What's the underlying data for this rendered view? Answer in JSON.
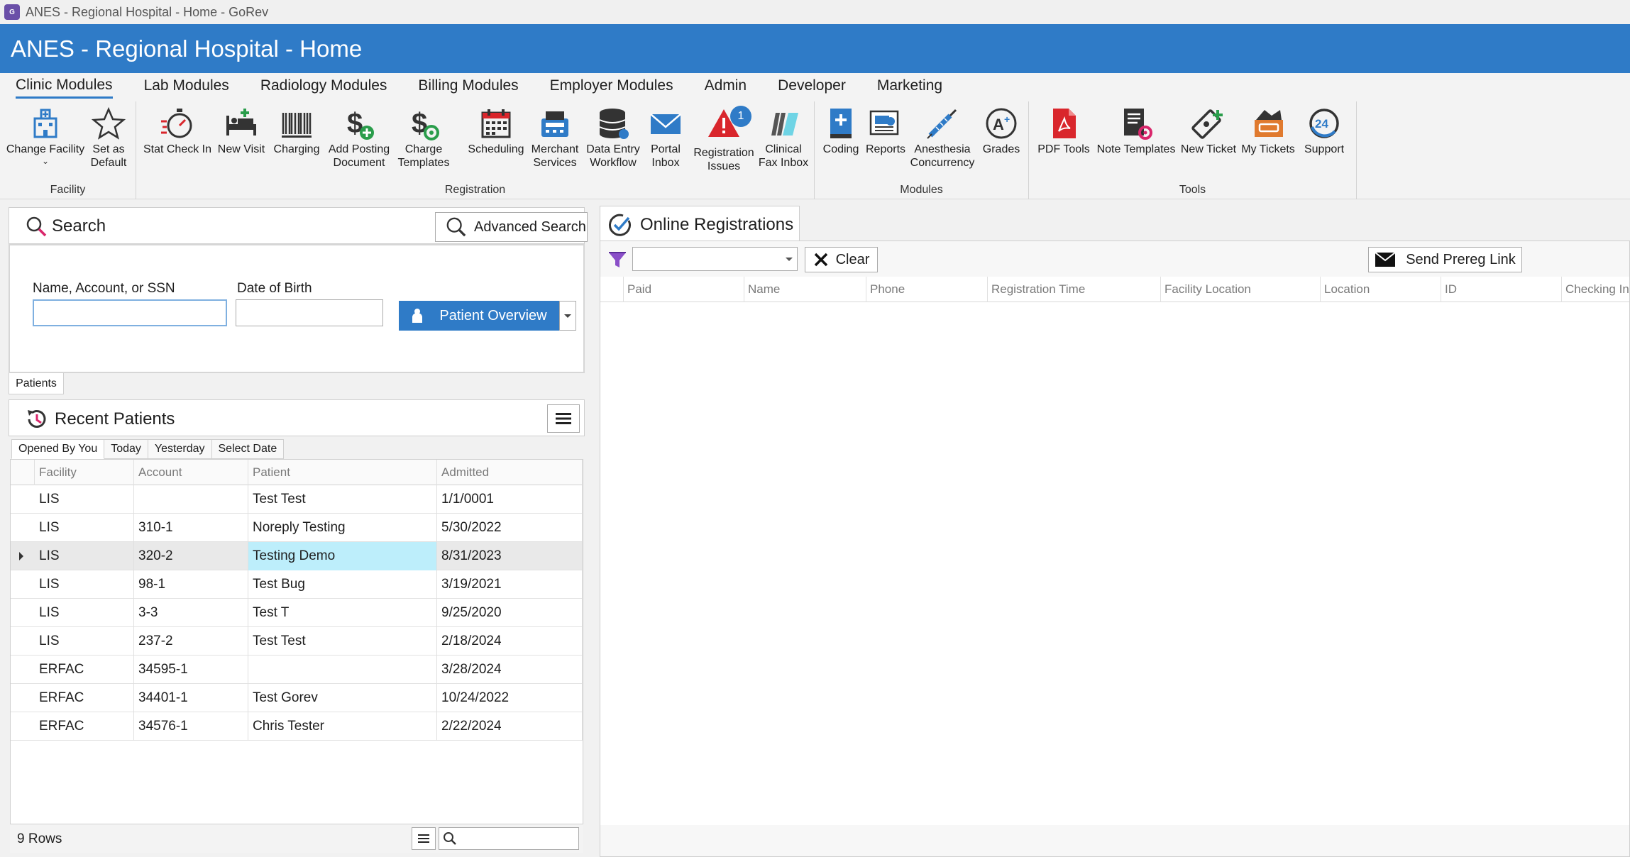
{
  "window": {
    "title": "ANES - Regional Hospital - Home - GoRev"
  },
  "header": {
    "title": "ANES - Regional Hospital - Home"
  },
  "menu": [
    "Clinic Modules",
    "Lab Modules",
    "Radiology Modules",
    "Billing Modules",
    "Employer Modules",
    "Admin",
    "Developer",
    "Marketing"
  ],
  "ribbon": {
    "groups": {
      "facility": "Facility",
      "registration": "Registration",
      "modules": "Modules",
      "tools": "Tools"
    },
    "buttons": {
      "change_facility": "Change Facility",
      "set_default": "Set as\nDefault",
      "stat_check_in": "Stat Check In",
      "new_visit": "New Visit",
      "charging": "Charging",
      "add_posting": "Add Posting\nDocument",
      "charge_templates": "Charge\nTemplates",
      "scheduling": "Scheduling",
      "merchant_services": "Merchant\nServices",
      "data_entry": "Data Entry\nWorkflow",
      "portal_inbox": "Portal\nInbox",
      "registration_issues": "Registration\nIssues",
      "registration_issues_badge": "1",
      "clinical_fax": "Clinical\nFax Inbox",
      "coding": "Coding",
      "reports": "Reports",
      "anesthesia": "Anesthesia\nConcurrency",
      "grades": "Grades",
      "pdf_tools": "PDF Tools",
      "note_templates": "Note Templates",
      "new_ticket": "New Ticket",
      "my_tickets": "My Tickets",
      "support": "Support"
    }
  },
  "search": {
    "title": "Search",
    "advanced_label": "Advanced Search",
    "name_label": "Name, Account, or SSN",
    "dob_label": "Date of Birth",
    "name_value": "",
    "dob_value": "",
    "overview_label": "Patient Overview",
    "tab_label": "Patients"
  },
  "recent": {
    "title": "Recent Patients",
    "tabs": [
      "Opened By You",
      "Today",
      "Yesterday",
      "Select Date"
    ],
    "columns": [
      "Facility",
      "Account",
      "Patient",
      "Admitted"
    ],
    "rows": [
      [
        "LIS",
        "",
        "Test Test",
        "1/1/0001"
      ],
      [
        "LIS",
        "310-1",
        "Noreply Testing",
        "5/30/2022"
      ],
      [
        "LIS",
        "320-2",
        "Testing Demo",
        "8/31/2023"
      ],
      [
        "LIS",
        "98-1",
        "Test Bug",
        "3/19/2021"
      ],
      [
        "LIS",
        "3-3",
        "Test T",
        "9/25/2020"
      ],
      [
        "LIS",
        "237-2",
        "Test Test",
        "2/18/2024"
      ],
      [
        "ERFAC",
        "34595-1",
        "",
        "3/28/2024"
      ],
      [
        "ERFAC",
        "34401-1",
        "Test Gorev",
        "10/24/2022"
      ],
      [
        "ERFAC",
        "34576-1",
        "Chris Tester",
        "2/22/2024"
      ]
    ],
    "row_count": "9 Rows"
  },
  "online": {
    "title": "Online Registrations",
    "clear_label": "Clear",
    "send_label": "Send Prereg Link",
    "columns": [
      "Paid",
      "Name",
      "Phone",
      "Registration Time",
      "Facility Location",
      "Location",
      "ID",
      "Checking In"
    ]
  },
  "colors": {
    "brand": "#2f7bc7",
    "selected_cell": "#bdeefb",
    "alert": "#d9262c"
  }
}
